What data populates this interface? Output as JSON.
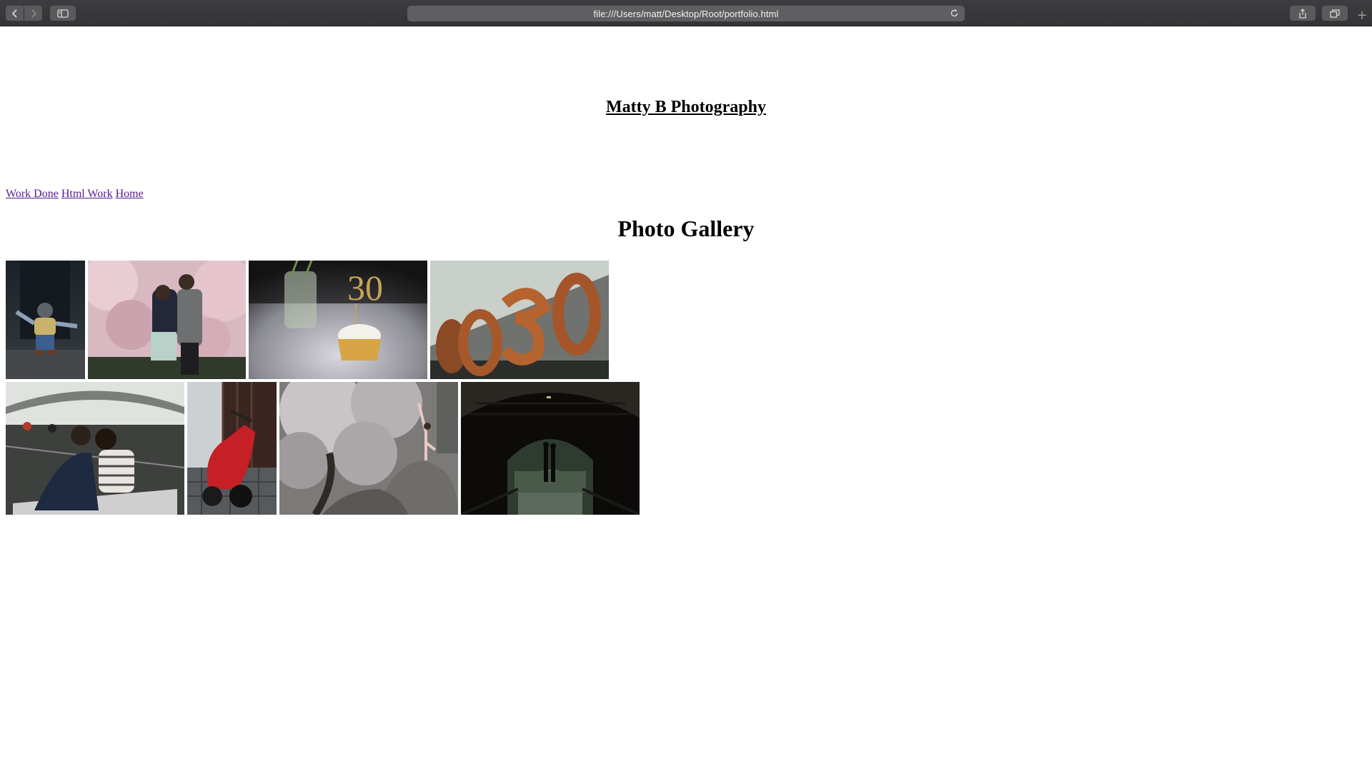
{
  "browser": {
    "url": "file:///Users/matt/Desktop/Root/portfolio.html",
    "buttons": {
      "back": "back-icon",
      "forward": "forward-icon",
      "sidebar": "sidebar-icon",
      "reload": "reload-icon",
      "share": "share-icon",
      "tabs": "tab-overview-icon",
      "new_tab": "+"
    }
  },
  "site": {
    "title": "Matty B Photography"
  },
  "nav": {
    "links": [
      {
        "label": "Work Done"
      },
      {
        "label": "Html Work"
      },
      {
        "label": "Home"
      }
    ]
  },
  "gallery": {
    "heading": "Photo Gallery",
    "photos": [
      {
        "subject": "child sitting in doorway"
      },
      {
        "subject": "couple kissing under cherry blossoms"
      },
      {
        "subject": "cupcake with 30 topper"
      },
      {
        "subject": "30 balloons"
      },
      {
        "subject": "couple kissing in rowboat"
      },
      {
        "subject": "red scooter"
      },
      {
        "subject": "dancer on rock under blossoms"
      },
      {
        "subject": "couple silhouette in tunnel"
      }
    ]
  },
  "colors": {
    "link_visited": "#551a8b",
    "toolbar": "#3a3a3c",
    "address_bar": "#5f5f62"
  }
}
